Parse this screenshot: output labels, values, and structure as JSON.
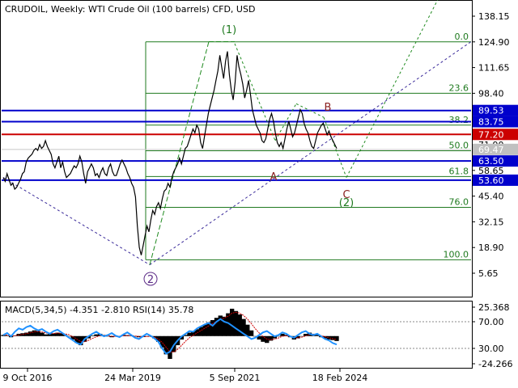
{
  "header": {
    "symbol": "CRUDOIL",
    "timeframe": "Weekly",
    "description": "WTI Crude Oil (100 barrels) CFD, USD",
    "title": "CRUDOIL, Weekly:  WTI Crude Oil (100 barrels) CFD, USD"
  },
  "indicator_header": {
    "text": "MACD(5,34,5) -4.351 -2.810 RSI(14) 35.78"
  },
  "colors": {
    "price_line": "#000000",
    "support_resistance": "#0000cc",
    "current_level": "#cc0000",
    "fibonacci": "#1f7a1f",
    "wave_label_impulse": "#1f7a1f",
    "wave_label_corrective": "#8b2020",
    "wave_label_cycle": "#5b2a86",
    "trend_dashed_green": "#1f8a1f",
    "trend_dashed_purple": "#3a2a9a",
    "rsi_line": "#1e90ff",
    "macd_hist": "#000000",
    "macd_signal": "#cc0000"
  },
  "chart_data": [
    {
      "type": "line",
      "panel": "price",
      "y_ticks": [
        "138.15",
        "124.90",
        "111.65",
        "98.40",
        "85.15",
        "71.90",
        "58.65",
        "45.40",
        "32.15",
        "18.90",
        "5.65"
      ],
      "ylim": [
        -1,
        142
      ],
      "x_ticks": [
        "9 Oct 2016",
        "24 Mar 2019",
        "5 Sep 2021",
        "18 Feb 2024"
      ],
      "price_markers": [
        {
          "value": 89.53,
          "label": "89.53",
          "color": "#0000cc"
        },
        {
          "value": 83.75,
          "label": "83.75",
          "color": "#0000cc"
        },
        {
          "value": 77.2,
          "label": "77.20",
          "color": "#cc0000"
        },
        {
          "value": 69.47,
          "label": "69.47",
          "color": "#c0c0c0"
        },
        {
          "value": 63.5,
          "label": "63.50",
          "color": "#0000cc"
        },
        {
          "value": 53.6,
          "label": "53.60",
          "color": "#0000cc"
        }
      ],
      "horizontal_levels": [
        89.53,
        83.75,
        77.2,
        63.5,
        53.6
      ],
      "fibonacci_levels": [
        {
          "label": "0.0",
          "value": 124.9
        },
        {
          "label": "23.6",
          "value": 98.4
        },
        {
          "label": "38.2",
          "value": 82.0
        },
        {
          "label": "50.0",
          "value": 68.8
        },
        {
          "label": "61.8",
          "value": 55.5
        },
        {
          "label": "76.0",
          "value": 39.6
        },
        {
          "label": "100.0",
          "value": 12.6
        }
      ],
      "wave_labels": [
        {
          "text": "(1)",
          "kind": "impulse"
        },
        {
          "text": "2",
          "kind": "cycle"
        },
        {
          "text": "A",
          "kind": "corrective"
        },
        {
          "text": "B",
          "kind": "corrective"
        },
        {
          "text": "C",
          "kind": "corrective"
        },
        {
          "text": "(2)",
          "kind": "impulse"
        }
      ],
      "series": [
        {
          "values": [
            55,
            53,
            57,
            54,
            51,
            52,
            49,
            50,
            52,
            54,
            57,
            58,
            63,
            65,
            66,
            67,
            69,
            70,
            69,
            72,
            70,
            71,
            74,
            71,
            69,
            67,
            62,
            60,
            63,
            66,
            60,
            63,
            58,
            55,
            56,
            57,
            59,
            61,
            60,
            62,
            66,
            63,
            57,
            52,
            58,
            60,
            62,
            60,
            56,
            57,
            55,
            58,
            60,
            57,
            56,
            60,
            62,
            58,
            56,
            56,
            59,
            62,
            64,
            62,
            60,
            57,
            55,
            52,
            50,
            45,
            30,
            19,
            15,
            20,
            25,
            30,
            27,
            33,
            38,
            36,
            40,
            42,
            39,
            44,
            48,
            49,
            52,
            50,
            55,
            58,
            60,
            62,
            65,
            62,
            66,
            70,
            71,
            74,
            77,
            80,
            78,
            82,
            80,
            73,
            70,
            76,
            82,
            88,
            92,
            96,
            100,
            105,
            110,
            118,
            112,
            106,
            115,
            120,
            108,
            100,
            95,
            104,
            118,
            112,
            108,
            103,
            96,
            100,
            105,
            98,
            90,
            86,
            82,
            80,
            78,
            74,
            73,
            75,
            80,
            85,
            88,
            84,
            78,
            73,
            71,
            73,
            70,
            75,
            80,
            84,
            80,
            76,
            78,
            82,
            86,
            90,
            88,
            83,
            80,
            78,
            74,
            71,
            70,
            74,
            78,
            80,
            82,
            83,
            80,
            77,
            79,
            76,
            74,
            72,
            70
          ]
        }
      ],
      "date_range": [
        "2016",
        "2025"
      ]
    },
    {
      "type": "area",
      "panel": "indicator",
      "y_ticks": [
        "25.368",
        "70.00",
        "30.00",
        "-24.266"
      ],
      "macd_hist": [
        1,
        0.5,
        -1,
        0.5,
        2,
        2.5,
        3,
        4,
        5,
        4.5,
        3,
        1.5,
        1.8,
        2.2,
        3,
        2.5,
        1,
        0,
        -3,
        -6,
        -8,
        -5,
        -2,
        0.5,
        1.5,
        2,
        1,
        0,
        -1,
        -0.5,
        0,
        1,
        0.8,
        0.2,
        -0.5,
        -1,
        -0.8,
        -0.3,
        0,
        -2,
        -5,
        -10,
        -16,
        -20,
        -14,
        -8,
        -3,
        1,
        3,
        4,
        6,
        8,
        10,
        12,
        14,
        16,
        18,
        17,
        20,
        24,
        22,
        19,
        15,
        10,
        5,
        0,
        -3,
        -5,
        -6,
        -4,
        -2,
        0,
        2,
        1,
        -1,
        -3,
        -2,
        0,
        2,
        3,
        2,
        1,
        -1,
        -2,
        -3,
        -3.5,
        -4.3
      ],
      "rsi": [
        50,
        53,
        48,
        55,
        60,
        58,
        62,
        64,
        60,
        57,
        59,
        55,
        52,
        56,
        58,
        54,
        50,
        46,
        42,
        38,
        36,
        44,
        48,
        52,
        55,
        51,
        48,
        50,
        53,
        49,
        47,
        51,
        54,
        50,
        46,
        44,
        48,
        52,
        49,
        45,
        40,
        30,
        22,
        25,
        35,
        42,
        48,
        52,
        56,
        55,
        60,
        63,
        66,
        68,
        64,
        70,
        74,
        70,
        68,
        64,
        60,
        56,
        52,
        48,
        44,
        46,
        50,
        54,
        56,
        52,
        48,
        50,
        54,
        52,
        48,
        46,
        50,
        54,
        56,
        52,
        50,
        52,
        48,
        44,
        42,
        38,
        35.78
      ]
    }
  ]
}
